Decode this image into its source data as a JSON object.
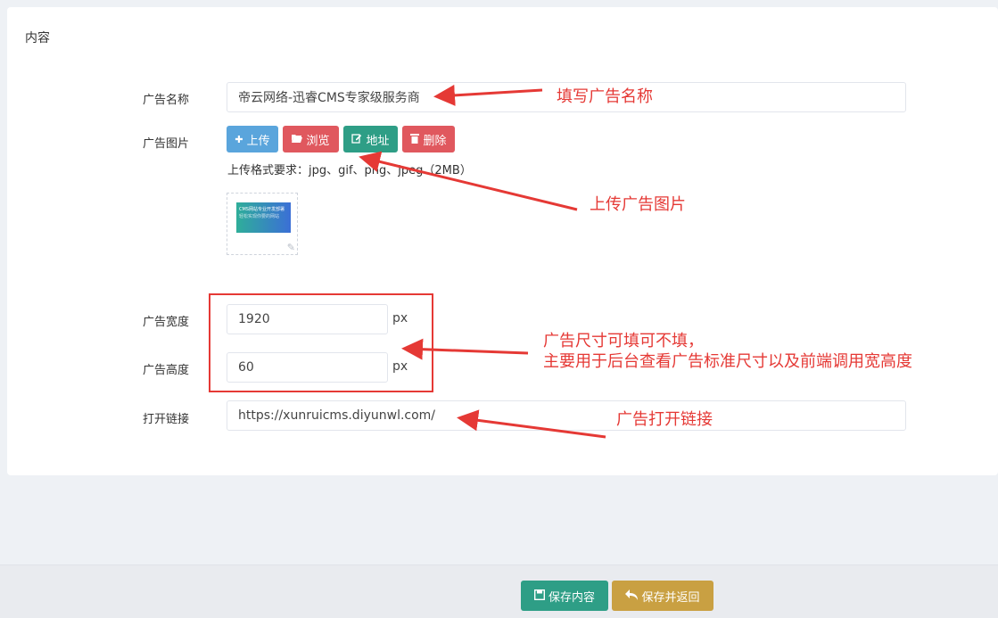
{
  "panel": {
    "title": "内容"
  },
  "form": {
    "ad_name_label": "广告名称",
    "ad_name_value": "帝云网络-迅睿CMS专家级服务商",
    "ad_image_label": "广告图片",
    "buttons": {
      "upload": "上传",
      "browse": "浏览",
      "address": "地址",
      "delete": "删除"
    },
    "upload_hint": "上传格式要求：jpg、gif、png、jpeg（2MB）",
    "thumb_lines": [
      "CMS网站专业开发部署",
      "轻松实现你要的网站"
    ],
    "width_label": "广告宽度",
    "width_value": "1920",
    "height_label": "广告高度",
    "height_value": "60",
    "unit": "px",
    "link_label": "打开链接",
    "link_value": "https://xunruicms.diyunwl.com/"
  },
  "annotations": {
    "fill_name": "填写广告名称",
    "upload_image": "上传广告图片",
    "size_line1": "广告尺寸可填可不填，",
    "size_line2": "主要用于后台查看广告标准尺寸以及前端调用宽高度",
    "open_link": "广告打开链接"
  },
  "footer": {
    "save": "保存内容",
    "save_return": "保存并返回"
  },
  "colors": {
    "upload_btn": "#5aa5dc",
    "browse_btn": "#e0585e",
    "address_btn": "#2e9e86",
    "delete_btn": "#e0585e",
    "save_btn": "#2e9e86",
    "save_return_btn": "#c9a042",
    "annotation_red": "#e53935"
  }
}
